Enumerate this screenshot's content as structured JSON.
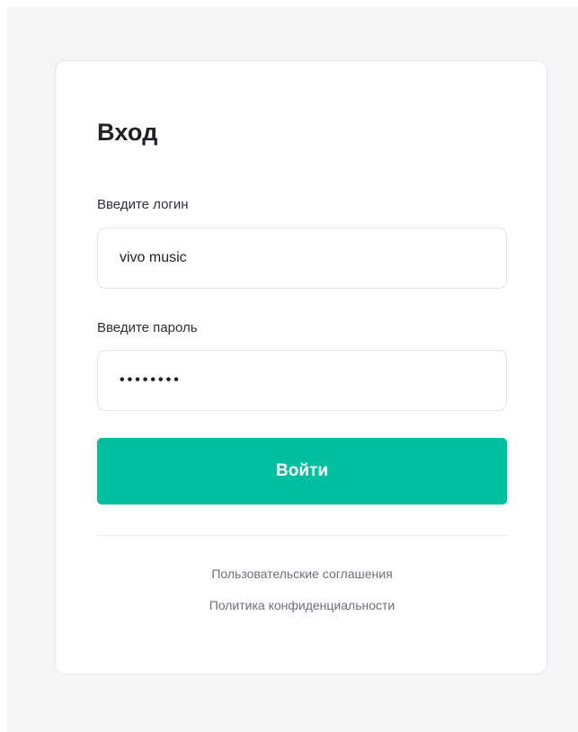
{
  "login_form": {
    "title": "Вход",
    "login_label": "Введите логин",
    "login_value": "vivo music",
    "password_label": "Введите пароль",
    "password_value": "••••••••",
    "submit_label": "Войти",
    "links": {
      "agreements": "Пользовательские соглашения",
      "privacy": "Политика конфиденциальности"
    }
  },
  "colors": {
    "accent": "#00bea0",
    "page_background": "#f5f5f7",
    "card_background": "#ffffff",
    "text_primary": "#1f2125",
    "text_secondary": "#6b6f77"
  }
}
